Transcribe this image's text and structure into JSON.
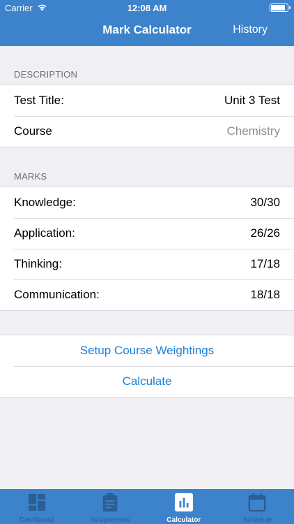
{
  "status_bar": {
    "carrier": "Carrier",
    "time": "12:08 AM",
    "battery_level": 0.9
  },
  "nav": {
    "title": "Mark Calculator",
    "right_button": "History"
  },
  "description": {
    "header": "DESCRIPTION",
    "rows": [
      {
        "label": "Test Title:",
        "value": "Unit 3 Test"
      },
      {
        "label": "Course",
        "value": "Chemistry"
      }
    ]
  },
  "marks": {
    "header": "MARKS",
    "rows": [
      {
        "label": "Knowledge:",
        "value": "30/30"
      },
      {
        "label": "Application:",
        "value": "26/26"
      },
      {
        "label": "Thinking:",
        "value": "17/18"
      },
      {
        "label": "Communication:",
        "value": "18/18"
      }
    ]
  },
  "actions": {
    "setup": "Setup Course Weightings",
    "calculate": "Calculate"
  },
  "tabbar": {
    "tabs": [
      {
        "label": "Dashboard",
        "icon": "dashboard-icon"
      },
      {
        "label": "Assignments",
        "icon": "clipboard-icon"
      },
      {
        "label": "Calculator",
        "icon": "bar-chart-icon",
        "active": true
      },
      {
        "label": "Schedule",
        "icon": "calendar-icon"
      }
    ]
  },
  "colors": {
    "accent": "#3d83cc",
    "link": "#1a7fd6",
    "background": "#efeff4"
  }
}
